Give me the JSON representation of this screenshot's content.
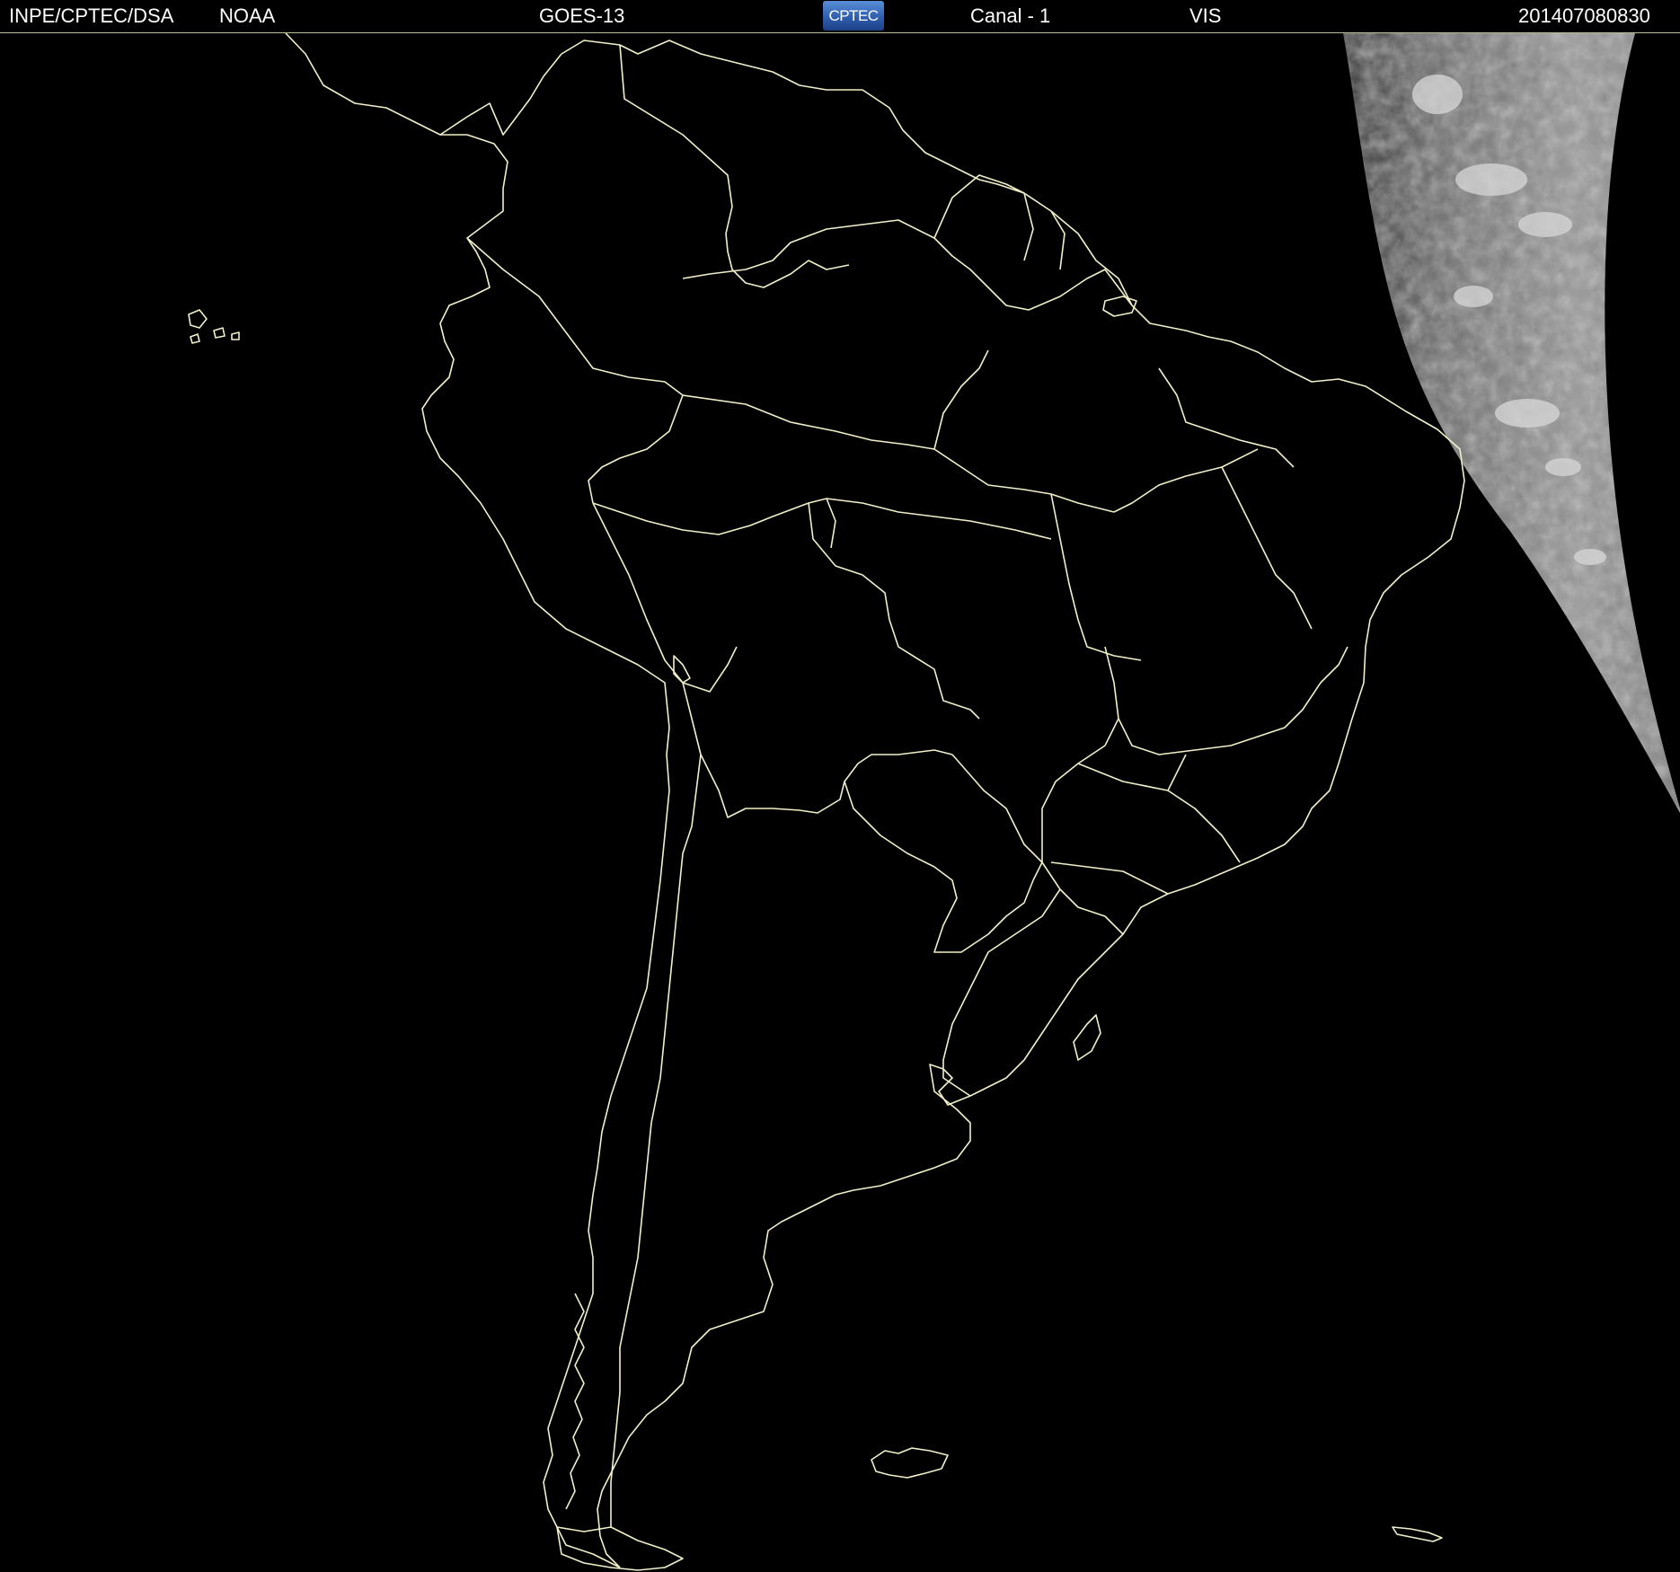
{
  "header": {
    "institution": "INPE/CPTEC/DSA",
    "agency": "NOAA",
    "satellite": "GOES-13",
    "logo_text": "CPTEC",
    "channel": "Canal - 1",
    "band": "VIS",
    "timestamp": "201407080830"
  },
  "colors": {
    "background": "#000000",
    "coastline": "#f2f0c8",
    "header_text": "#ffffff",
    "logo_blue": "#2f5fb0",
    "clouds_gray": "#8c8c8c"
  },
  "map": {
    "region": "South America",
    "imagery": "visible satellite channel, night-side dark with daylight terminator on the east"
  }
}
